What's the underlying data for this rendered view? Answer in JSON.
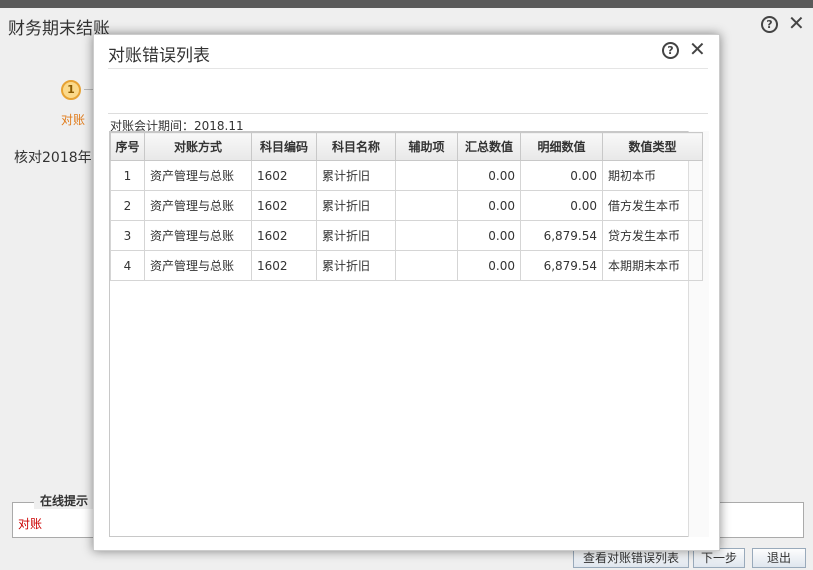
{
  "background": {
    "title": "财务期末结账",
    "step": {
      "number": "1",
      "label": "对账"
    },
    "description": "核对2018年",
    "tip": {
      "legend": "在线提示",
      "text": "对账"
    },
    "buttons": {
      "view": "查看对账错误列表",
      "next": "下一步",
      "exit": "退出"
    }
  },
  "modal": {
    "title": "对账错误列表",
    "period_label": "对账会计期间：",
    "period_value": "2018.11",
    "columns": [
      "序号",
      "对账方式",
      "科目编码",
      "科目名称",
      "辅助项",
      "汇总数值",
      "明细数值",
      "数值类型"
    ],
    "rows": [
      {
        "seq": "1",
        "method": "资产管理与总账",
        "code": "1602",
        "name": "累计折旧",
        "aux": "",
        "summary": "0.00",
        "detail": "0.00",
        "type": "期初本币"
      },
      {
        "seq": "2",
        "method": "资产管理与总账",
        "code": "1602",
        "name": "累计折旧",
        "aux": "",
        "summary": "0.00",
        "detail": "0.00",
        "type": "借方发生本币"
      },
      {
        "seq": "3",
        "method": "资产管理与总账",
        "code": "1602",
        "name": "累计折旧",
        "aux": "",
        "summary": "0.00",
        "detail": "6,879.54",
        "type": "贷方发生本币"
      },
      {
        "seq": "4",
        "method": "资产管理与总账",
        "code": "1602",
        "name": "累计折旧",
        "aux": "",
        "summary": "0.00",
        "detail": "6,879.54",
        "type": "本期期末本币"
      }
    ]
  },
  "icons": {
    "help": "question-circle-icon",
    "close": "close-x-icon"
  },
  "colors": {
    "step_accent": "#e7a233",
    "tip_text": "#cc0000",
    "step_label": "#e07b1a"
  }
}
